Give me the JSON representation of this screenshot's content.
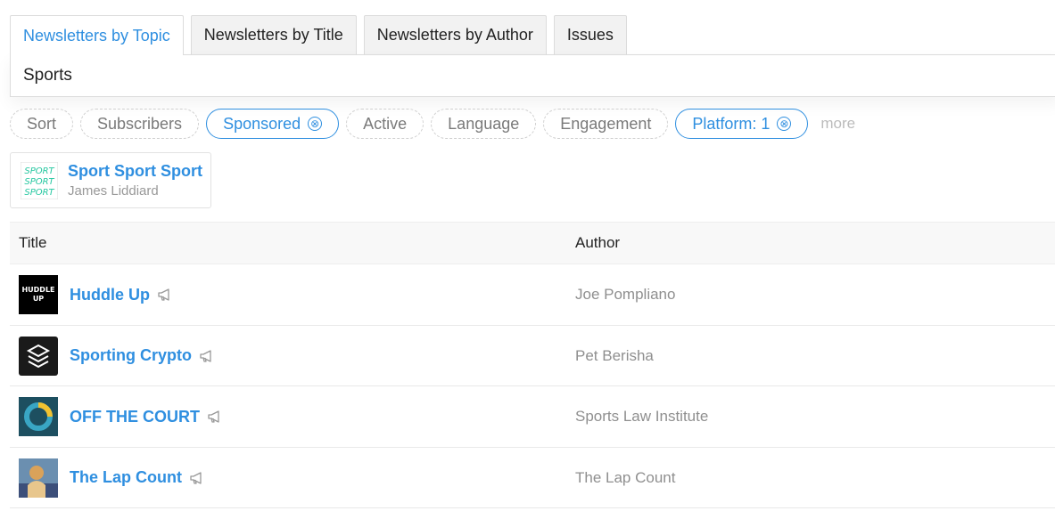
{
  "tabs": [
    {
      "label": "Newsletters by Topic",
      "active": true
    },
    {
      "label": "Newsletters by Title",
      "active": false
    },
    {
      "label": "Newsletters by Author",
      "active": false
    },
    {
      "label": "Issues",
      "active": false
    }
  ],
  "search": {
    "value": "Sports"
  },
  "filters": {
    "sort": "Sort",
    "subscribers": "Subscribers",
    "sponsored": "Sponsored",
    "active": "Active",
    "language": "Language",
    "engagement": "Engagement",
    "platform": "Platform: 1",
    "more": "more",
    "clear_glyph": "⊗"
  },
  "featured": {
    "title": "Sport Sport Sport",
    "author": "James Liddiard",
    "thumb_text": [
      "SPORT",
      "SPORT",
      "SPORT"
    ]
  },
  "table": {
    "headers": {
      "title": "Title",
      "author": "Author"
    },
    "rows": [
      {
        "title": "Huddle Up",
        "author": "Joe Pompliano",
        "logo_text": [
          "HUDDLE",
          "UP"
        ]
      },
      {
        "title": "Sporting Crypto",
        "author": "Pet Berisha"
      },
      {
        "title": "OFF THE COURT",
        "author": "Sports Law Institute"
      },
      {
        "title": "The Lap Count",
        "author": "The Lap Count"
      }
    ]
  },
  "colors": {
    "accent": "#2f8fe0",
    "muted": "#8f8f8f",
    "border": "#dcdcdc"
  }
}
